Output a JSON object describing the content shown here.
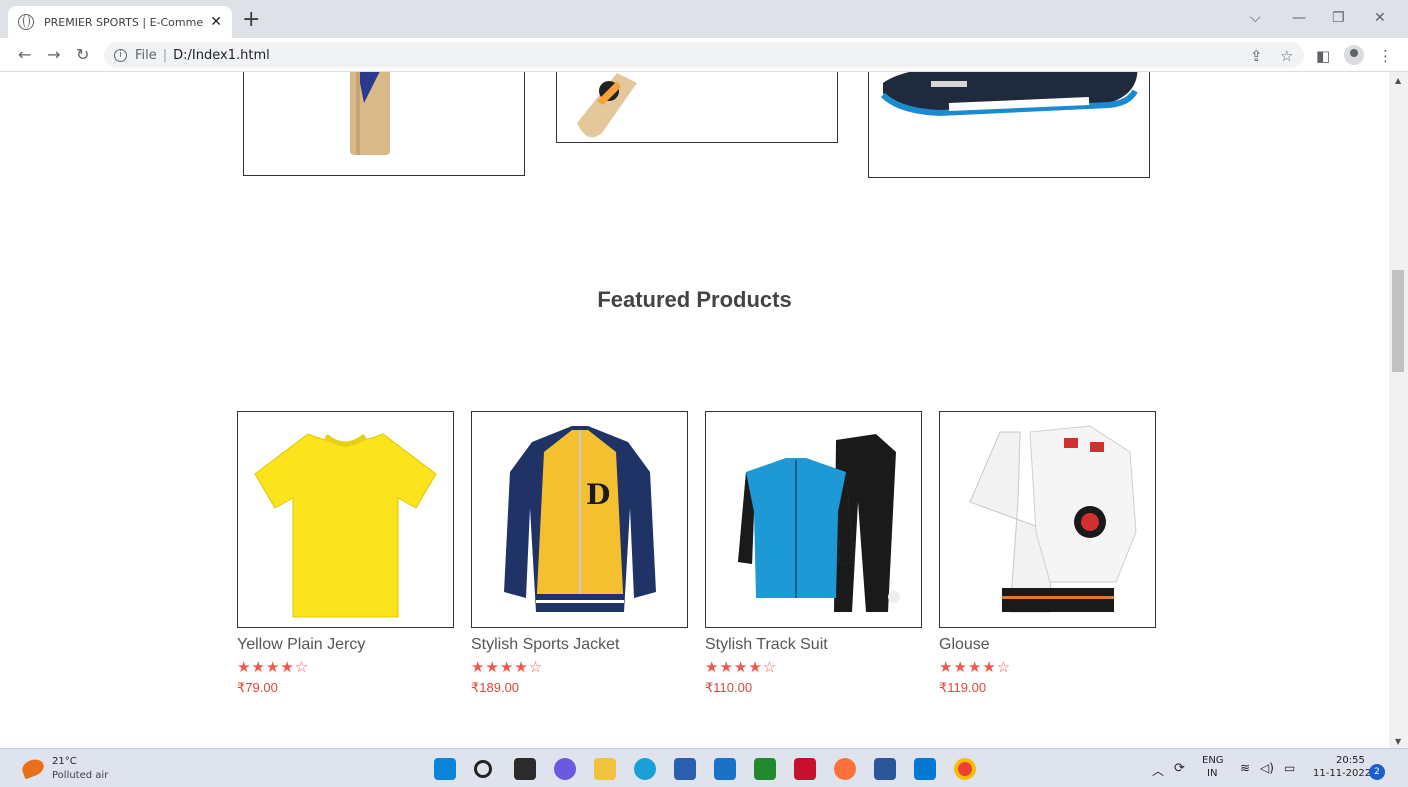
{
  "browser": {
    "tab_title": "PREMIER SPORTS | E-Commerce",
    "tab_close": "✕",
    "new_tab": "+",
    "url_scheme": "File",
    "url_path": "D:/Index1.html",
    "nav_icons": [
      "back-arrow-icon",
      "forward-arrow-icon",
      "reload-icon"
    ],
    "toolbar_icons": [
      "share-icon",
      "bookmark-star-icon",
      "side-panel-icon",
      "profile-icon",
      "menu-icon"
    ]
  },
  "page": {
    "section_title": "Featured Products",
    "products": [
      {
        "name": "Yellow Plain Jercy",
        "stars": "★★★★☆",
        "rating": 4,
        "price": "₹79.00"
      },
      {
        "name": "Stylish Sports Jacket",
        "stars": "★★★★☆",
        "rating": 4,
        "price": "₹189.00"
      },
      {
        "name": "Stylish Track Suit",
        "stars": "★★★★☆",
        "rating": 4,
        "price": "₹110.00"
      },
      {
        "name": "Glouse",
        "stars": "★★★★☆",
        "rating": 4,
        "price": "₹119.00"
      }
    ],
    "colors": {
      "star": "#f2574c",
      "price": "#e0463a",
      "title": "#444444"
    }
  },
  "taskbar": {
    "weather_temp": "21°C",
    "weather_desc": "Polluted air",
    "lang_top": "ENG",
    "lang_bottom": "IN",
    "time": "20:55",
    "date": "11-11-2022",
    "notifications": "2"
  }
}
